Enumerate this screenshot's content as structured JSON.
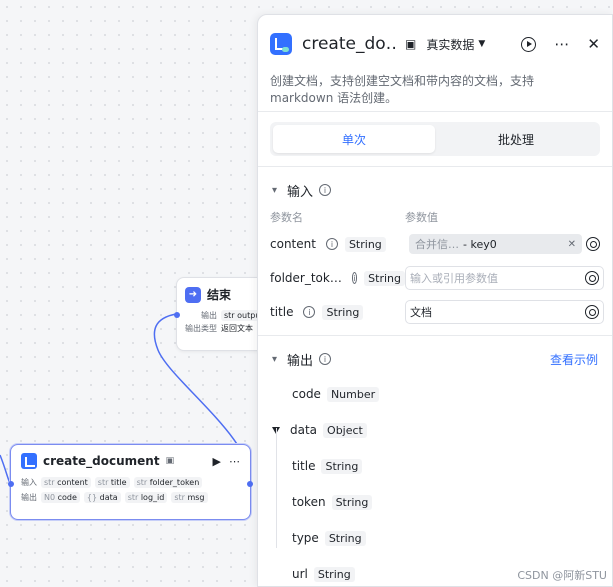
{
  "canvas": {
    "end_node": {
      "title": "结束",
      "output_label": "输出",
      "output_param": "str output",
      "output_type_label": "输出类型",
      "output_type_value": "返回文本"
    },
    "create_node": {
      "title": "create_document",
      "run_icon": "▶",
      "more_icon": "⋯",
      "input_label": "输入",
      "inputs": [
        {
          "type": "str",
          "name": "content"
        },
        {
          "type": "str",
          "name": "title"
        },
        {
          "type": "str",
          "name": "folder_token"
        }
      ],
      "output_label": "输出",
      "outputs": [
        {
          "type": "N0",
          "name": "code"
        },
        {
          "type": "{}",
          "name": "data"
        },
        {
          "type": "str",
          "name": "log_id"
        },
        {
          "type": "str",
          "name": "msg"
        }
      ]
    }
  },
  "panel": {
    "title": "create_do…",
    "mode": "真实数据",
    "description": "创建文档，支持创建空文档和带内容的文档，支持 markdown 语法创建。",
    "tabs": [
      "单次",
      "批处理"
    ],
    "input_section": {
      "title": "输入",
      "col_name": "参数名",
      "col_value": "参数值",
      "params": [
        {
          "name": "content",
          "type": "String",
          "ref_source": "合并信…",
          "ref_key": "- key0"
        },
        {
          "name": "folder_tok…",
          "type": "String",
          "placeholder": "输入或引用参数值"
        },
        {
          "name": "title",
          "type": "String",
          "value": "文档"
        }
      ]
    },
    "output_section": {
      "title": "输出",
      "example_link": "查看示例",
      "fields": [
        {
          "name": "code",
          "type": "Number"
        },
        {
          "name": "data",
          "type": "Object"
        },
        {
          "name": "title",
          "type": "String"
        },
        {
          "name": "token",
          "type": "String"
        },
        {
          "name": "type",
          "type": "String"
        },
        {
          "name": "url",
          "type": "String"
        }
      ]
    }
  },
  "watermark": "CSDN @阿新STU",
  "colors": {
    "accent": "#3370ff",
    "edge": "#4e6ef2"
  }
}
